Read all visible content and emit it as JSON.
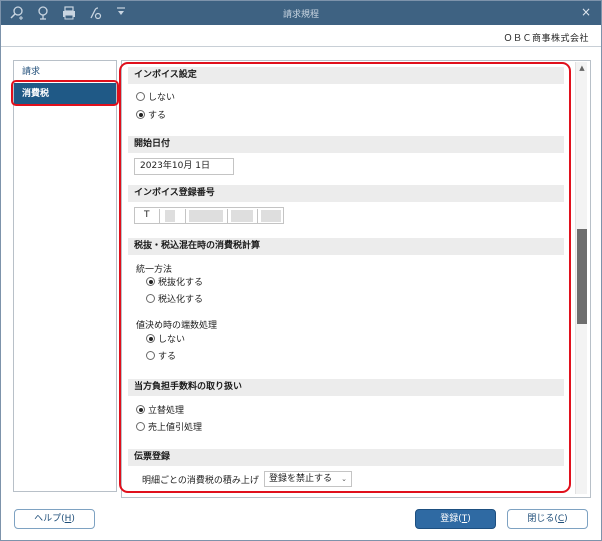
{
  "window": {
    "title": "請求規程",
    "close_glyph": "×",
    "toolbar_icons": [
      "search-plus-icon",
      "zoom-icon",
      "print-icon",
      "settings-tool-icon",
      "dropdown-arrow-icon"
    ]
  },
  "header": {
    "company": "ＯＢＣ商事株式会社"
  },
  "sidebar": {
    "items": [
      {
        "label": "請求",
        "active": false
      },
      {
        "label": "消費税",
        "active": true
      }
    ]
  },
  "invoice_setting": {
    "heading": "インボイス設定",
    "options": [
      {
        "label": "しない",
        "selected": false
      },
      {
        "label": "する",
        "selected": true
      }
    ]
  },
  "start_date": {
    "heading": "開始日付",
    "value": "2023年10月  1日"
  },
  "registration_number": {
    "heading": "インボイス登録番号",
    "prefix": "T"
  },
  "tax_calc": {
    "heading": "税抜・税込混在時の消費税計算",
    "unify_label": "統一方法",
    "unify_options": [
      {
        "label": "税抜化する",
        "selected": true
      },
      {
        "label": "税込化する",
        "selected": false
      }
    ],
    "rounding_label": "値決め時の端数処理",
    "rounding_options": [
      {
        "label": "しない",
        "selected": true
      },
      {
        "label": "する",
        "selected": false
      }
    ]
  },
  "fee_handling": {
    "heading": "当方負担手数料の取り扱い",
    "options": [
      {
        "label": "立替処理",
        "selected": true
      },
      {
        "label": "売上値引処理",
        "selected": false
      }
    ]
  },
  "slip": {
    "heading": "伝票登録",
    "accumulate_label": "明細ごとの消費税の積み上げ",
    "accumulate_value": "登録を禁止する"
  },
  "buttons": {
    "help": {
      "label": "ヘルプ(",
      "key": "H",
      "suffix": ")"
    },
    "register": {
      "label": "登録(",
      "key": "T",
      "suffix": ")"
    },
    "close": {
      "label": "閉じる(",
      "key": "C",
      "suffix": ")"
    }
  },
  "colors": {
    "titlebar": "#3e6282",
    "sidebar_active": "#1f5986",
    "highlight_red": "#e0101c",
    "primary_button": "#2f6aa3"
  }
}
